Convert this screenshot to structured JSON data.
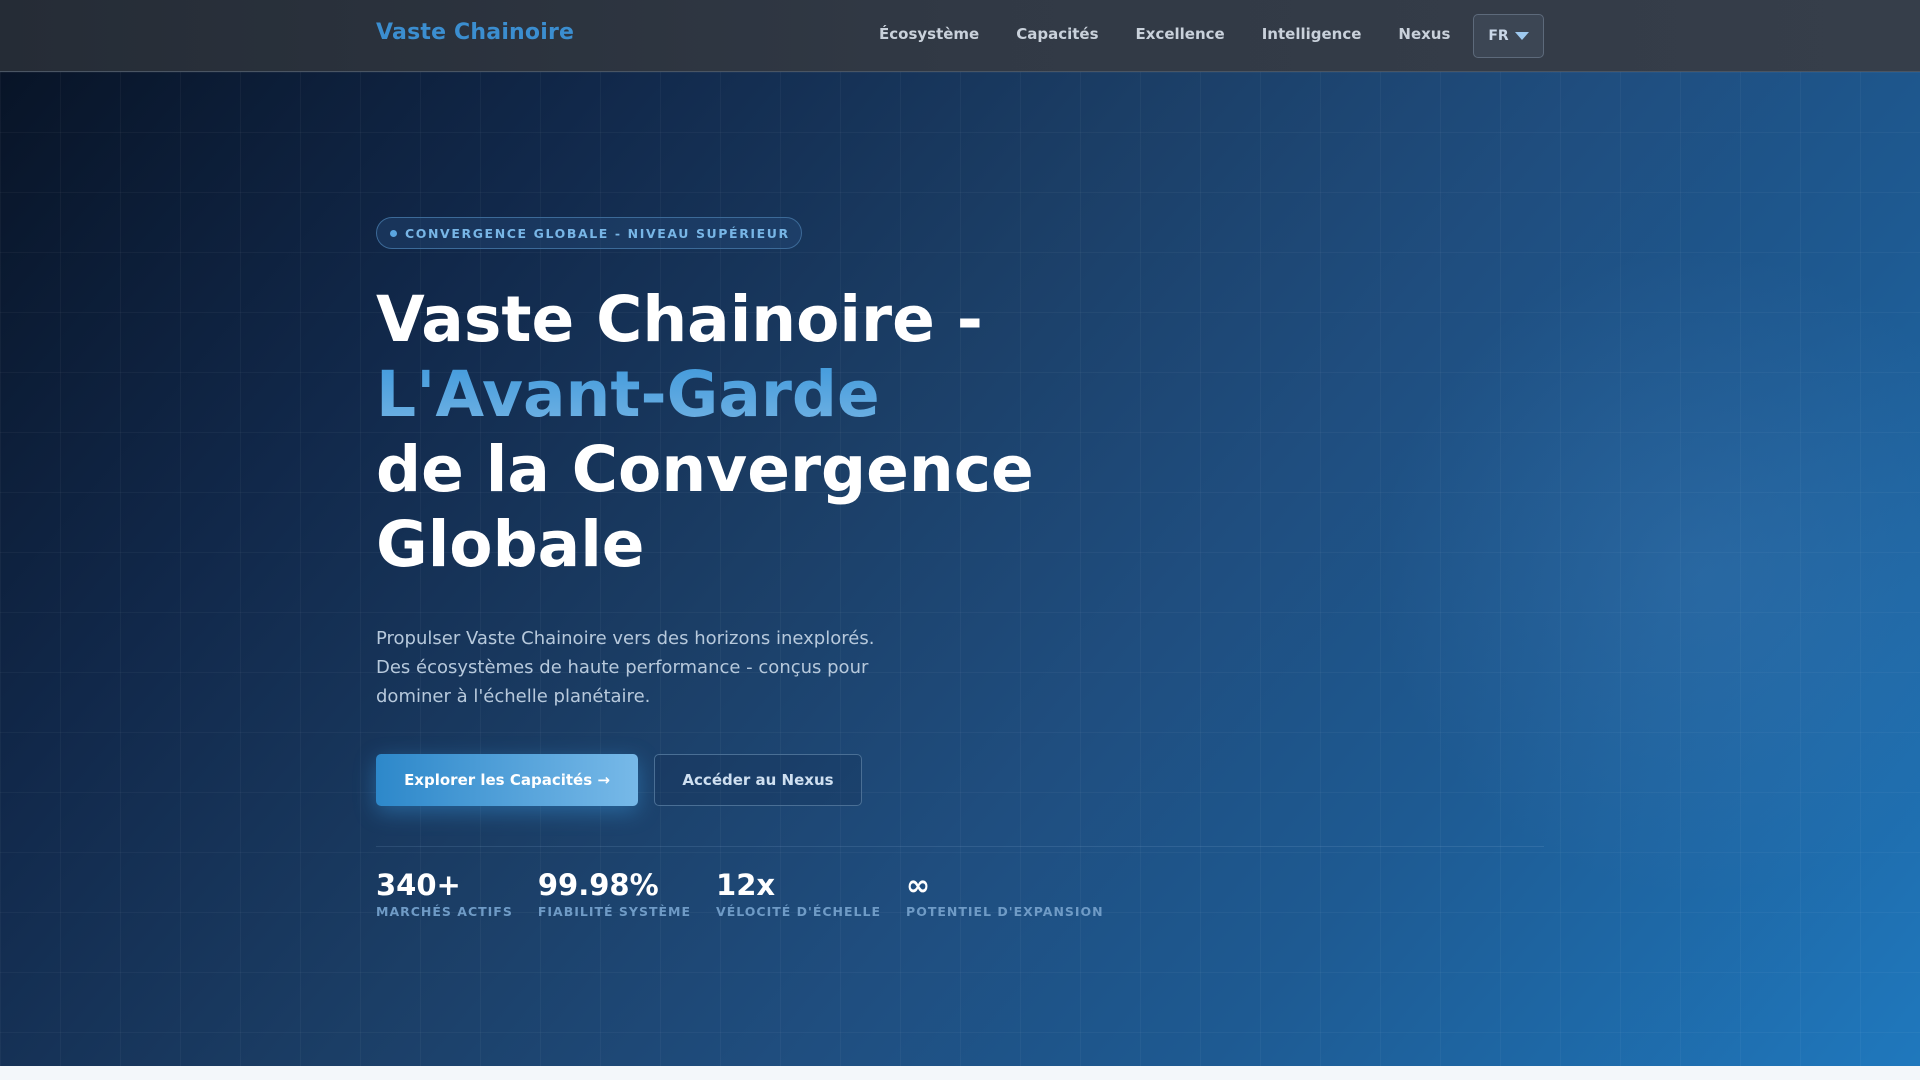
{
  "nav": {
    "brand": "Vaste Chainoire",
    "links": [
      "Écosystème",
      "Capacités",
      "Excellence",
      "Intelligence",
      "Nexus"
    ],
    "language": "FR",
    "language_icon": "chevron-down-icon"
  },
  "hero": {
    "badge": "CONVERGENCE GLOBALE - NIVEAU SUPÉRIEUR",
    "headline_part1": "Vaste Chainoire - ",
    "headline_accent": "L'Avant-Garde",
    "headline_part2": "de la Convergence Globale",
    "lead": "Propulser Vaste Chainoire vers des horizons inexplorés. Des écosystèmes de haute performance - conçus pour dominer à l'échelle planétaire.",
    "primary_button": "Explorer les Capacités →",
    "secondary_button": "Accéder au Nexus",
    "stats": [
      {
        "value": "340+",
        "label": "MARCHÉS ACTIFS"
      },
      {
        "value": "99.98%",
        "label": "FIABILITÉ SYSTÈME"
      },
      {
        "value": "12x",
        "label": "VÉLOCITÉ D'ÉCHELLE"
      },
      {
        "value": "∞",
        "label": "POTENTIEL D'EXPANSION"
      }
    ]
  },
  "colors": {
    "accent": "#3b8ed0",
    "nav_background": "#313945",
    "hero_dark": "#081427",
    "hero_light": "#1f78bd"
  }
}
